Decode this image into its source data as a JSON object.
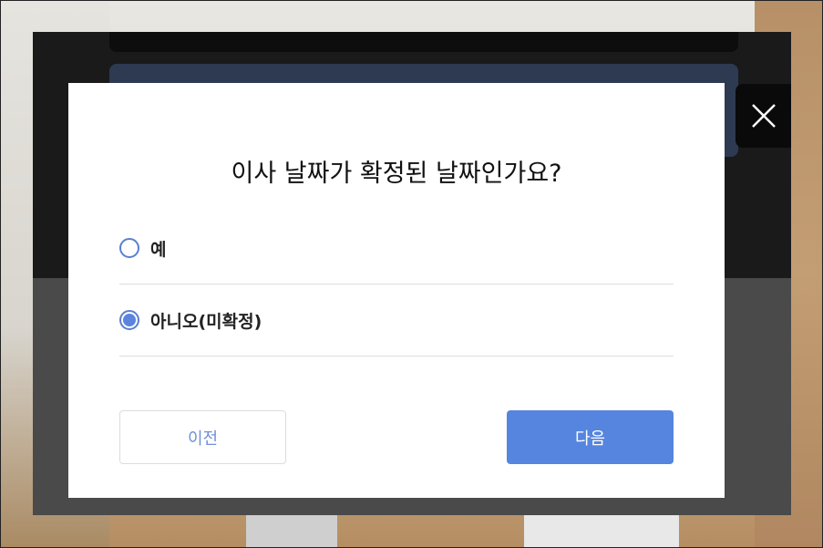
{
  "dialog": {
    "question": "이사 날짜가 확정된 날짜인가요?",
    "options": [
      {
        "label": "예",
        "selected": false
      },
      {
        "label": "아니오(미확정)",
        "selected": true
      }
    ],
    "prev_label": "이전",
    "next_label": "다음"
  },
  "icons": {
    "close": "close-icon"
  },
  "colors": {
    "accent": "#5585de",
    "radio_border": "#5b7fd0",
    "prev_text": "#6f8fd6"
  }
}
